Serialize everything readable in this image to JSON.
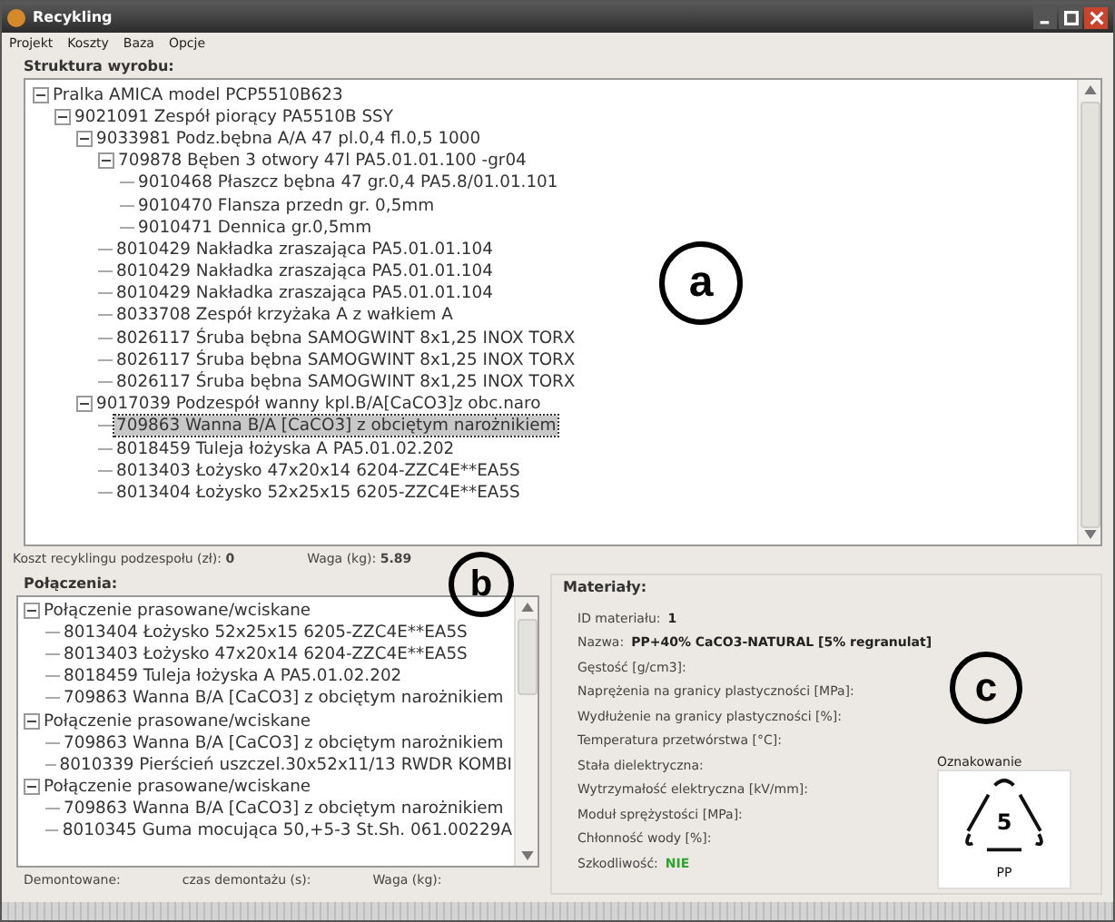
{
  "window": {
    "title": "Recykling"
  },
  "menu": [
    "Projekt",
    "Koszty",
    "Baza",
    "Opcje"
  ],
  "structure": {
    "label": "Struktura wyrobu:",
    "tree": [
      {
        "text": "Pralka AMICA model PCP5510B623",
        "expanded": true,
        "selected": false,
        "children": [
          {
            "text": "9021091 Zespół piorący PA5510B SSY",
            "expanded": true,
            "selected": false,
            "children": [
              {
                "text": "9033981 Podz.bębna A/A 47 pl.0,4 fl.0,5 1000",
                "expanded": true,
                "selected": false,
                "children": [
                  {
                    "text": "709878 Bęben 3 otwory 47l PA5.01.01.100 -gr04",
                    "expanded": true,
                    "selected": false,
                    "children": [
                      {
                        "text": "9010468 Płaszcz bębna 47 gr.0,4  PA5.8/01.01.101",
                        "selected": false
                      },
                      {
                        "text": "9010470 Flansza przedn gr. 0,5mm",
                        "selected": false
                      },
                      {
                        "text": "9010471 Dennica gr.0,5mm",
                        "selected": false
                      }
                    ]
                  },
                  {
                    "text": "8010429 Nakładka zraszająca  PA5.01.01.104",
                    "selected": false
                  },
                  {
                    "text": "8010429 Nakładka zraszająca  PA5.01.01.104",
                    "selected": false
                  },
                  {
                    "text": "8010429 Nakładka zraszająca  PA5.01.01.104",
                    "selected": false
                  },
                  {
                    "text": "8033708 Zespół krzyżaka A  z wałkiem A",
                    "selected": false
                  },
                  {
                    "text": "8026117 Śruba bębna SAMOGWINT 8x1,25 INOX TORX",
                    "selected": false
                  },
                  {
                    "text": "8026117 Śruba bębna SAMOGWINT 8x1,25 INOX TORX",
                    "selected": false
                  },
                  {
                    "text": "8026117 Śruba bębna SAMOGWINT 8x1,25 INOX TORX",
                    "selected": false
                  }
                ]
              },
              {
                "text": "9017039 Podzespół wanny kpl.B/A[CaCO3]z obc.naro",
                "expanded": true,
                "selected": false,
                "children": [
                  {
                    "text": "709863 Wanna B/A [CaCO3] z obciętym narożnikiem",
                    "selected": true
                  },
                  {
                    "text": "8018459 Tuleja łożyska A PA5.01.02.202",
                    "selected": false
                  },
                  {
                    "text": "8013403 Łożysko 47x20x14 6204-ZZC4E**EA5S",
                    "selected": false
                  },
                  {
                    "text": "8013404 Łożysko 52x25x15 6205-ZZC4E**EA5S",
                    "selected": false
                  }
                ]
              }
            ]
          }
        ]
      }
    ],
    "stats": [
      {
        "label": "Koszt recyklingu podzespołu (zł):",
        "value": "0"
      },
      {
        "label": "Waga (kg):",
        "value": "5.89"
      }
    ]
  },
  "connections": {
    "label": "Połączenia:",
    "groups": [
      {
        "text": "Połączenie prasowane/wciskane",
        "expanded": true,
        "items": [
          "8013404 Łożysko 52x25x15 6205-ZZC4E**EA5S",
          "8013403 Łożysko 47x20x14 6204-ZZC4E**EA5S",
          "8018459 Tuleja łożyska A PA5.01.02.202",
          "709863 Wanna B/A [CaCO3] z obciętym narożnikiem"
        ]
      },
      {
        "text": "Połączenie prasowane/wciskane",
        "expanded": true,
        "items": [
          "709863 Wanna B/A [CaCO3] z obciętym narożnikiem",
          "8010339 Pierścień uszczel.30x52x11/13 RWDR KOMBI"
        ]
      },
      {
        "text": "Połączenie prasowane/wciskane",
        "expanded": true,
        "items": [
          "709863 Wanna B/A [CaCO3] z obciętym narożnikiem",
          "8010345 Guma mocująca 50,+5-3 St.Sh. 061.00229A"
        ]
      }
    ],
    "stats": [
      "Demontowane:",
      "czas demontażu (s):",
      "Waga (kg):"
    ]
  },
  "materials": {
    "label": "Materiały:",
    "fields": [
      {
        "label": "ID materiału:",
        "value": "1",
        "kind": "bold"
      },
      {
        "label": "Nazwa:",
        "value": "PP+40% CaCO3-NATURAL [5% regranulat]",
        "kind": "bold"
      },
      {
        "label": "Gęstość [g/cm3]:"
      },
      {
        "label": "Naprężenia na granicy plastyczności [MPa]:"
      },
      {
        "label": "Wydłużenie na granicy plastyczności [%]:"
      },
      {
        "label": "Temperatura przetwórstwa [°C]:"
      },
      {
        "label": "Stała dielektryczna:"
      },
      {
        "label": "Wytrzymałość elektryczna [kV/mm]:"
      },
      {
        "label": "Moduł sprężystości [MPa]:"
      },
      {
        "label": "Chłonność wody [%]:"
      },
      {
        "label": "Szkodliwość:",
        "value": "NIE",
        "kind": "status"
      }
    ],
    "marking": {
      "label": "Oznakowanie",
      "number": "5",
      "code": "PP"
    }
  },
  "annotations": [
    "a",
    "b",
    "c"
  ]
}
